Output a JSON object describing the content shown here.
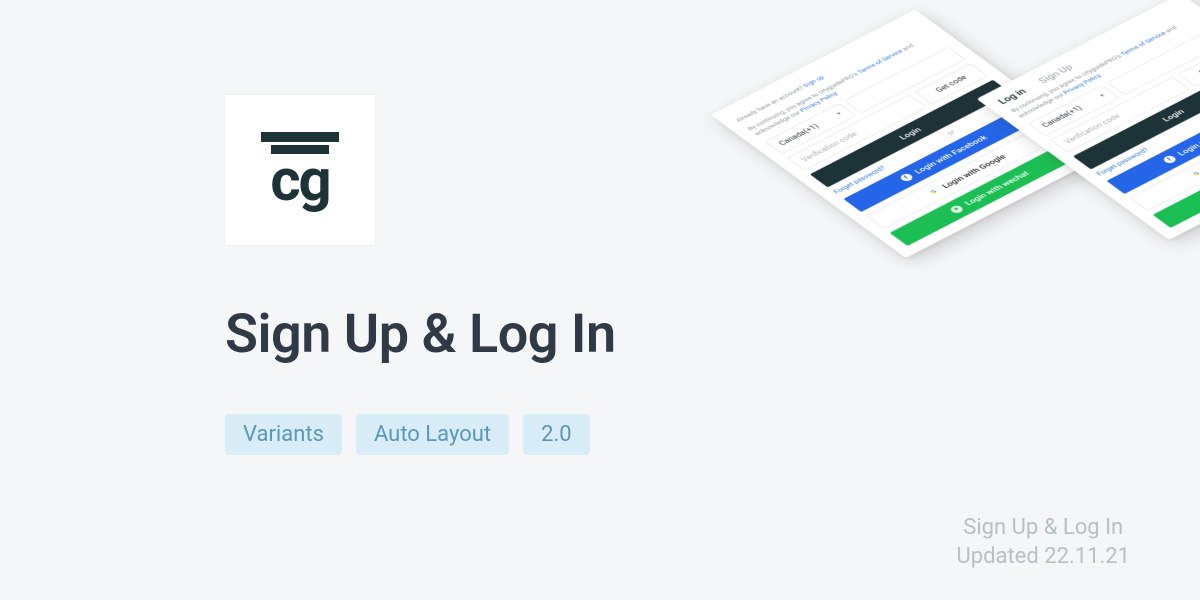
{
  "logo": {
    "letters": "cg"
  },
  "title": "Sign Up & Log In",
  "tags": [
    "Variants",
    "Auto Layout",
    "2.0"
  ],
  "meta": {
    "line1": "Sign Up & Log In",
    "line2": "Updated 22.11.21"
  },
  "mock": {
    "tabs": {
      "login": "Log in",
      "signup": "Sign Up"
    },
    "already_prefix": "Already have an account? ",
    "already_link": "Sign up",
    "consent_prefix": "By continuing, you agree to cityguidePRO's ",
    "terms": "Terms of Service",
    "consent_mid": " and acknowledge our ",
    "privacy": "Privacy Policy",
    "period": ".",
    "country": "Canada(+1)",
    "verification_placeholder": "Verification code",
    "get_code": "Get code",
    "login_btn": "Login",
    "forgot": "Forget password?",
    "or": "or",
    "facebook": "Login with Facebook",
    "google": "Login with Google",
    "wechat": "Login with wechat"
  }
}
